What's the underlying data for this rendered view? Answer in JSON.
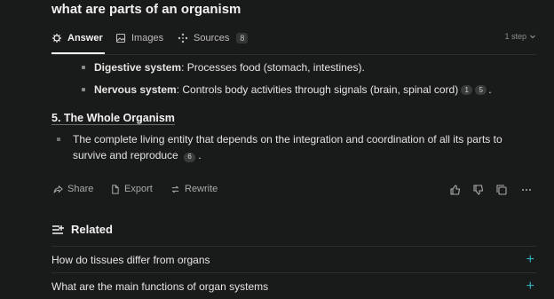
{
  "query": "what are parts of an organism",
  "tabs": [
    {
      "label": "Answer",
      "icon": "answer-icon"
    },
    {
      "label": "Images",
      "icon": "image-icon"
    },
    {
      "label": "Sources",
      "icon": "sources-icon",
      "count": "8"
    }
  ],
  "steps": "1 step",
  "bullets": [
    {
      "term": "Digestive system",
      "desc": ": Processes food (stomach, intestines).",
      "cites": []
    },
    {
      "term": "Nervous system",
      "desc": ": Controls body activities through signals (brain, spinal cord)",
      "cites": [
        "1",
        "5"
      ],
      "end": "."
    }
  ],
  "section_heading": "5. The Whole Organism",
  "paragraph": {
    "text": "The complete living entity that depends on the integration and coordination of all its parts to survive and reproduce",
    "cite": "6",
    "end": "."
  },
  "actions": {
    "share": "Share",
    "export": "Export",
    "rewrite": "Rewrite"
  },
  "related": {
    "title": "Related",
    "items": [
      "How do tissues differ from organs",
      "What are the main functions of organ systems"
    ]
  },
  "colors": {
    "accent": "#2fb4c2",
    "background": "#191a1a"
  }
}
